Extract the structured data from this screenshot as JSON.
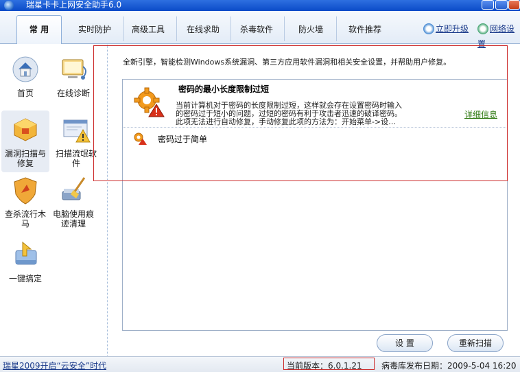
{
  "window": {
    "title": "瑞星卡卡上网安全助手6.0"
  },
  "tabs": [
    {
      "label": "常 用",
      "active": true
    },
    {
      "label": "实时防护"
    },
    {
      "label": "高级工具"
    },
    {
      "label": "在线求助"
    },
    {
      "label": "杀毒软件"
    },
    {
      "label": "防火墙"
    },
    {
      "label": "软件推荐"
    }
  ],
  "top_actions": {
    "upgrade": "立即升级",
    "network": "网络设置"
  },
  "sidebar": {
    "items": [
      {
        "label": "首页",
        "icon": "home-icon"
      },
      {
        "label": "在线诊断",
        "icon": "diagnose-icon"
      },
      {
        "label": "漏洞扫描与修复",
        "icon": "vuln-scan-icon",
        "active": true
      },
      {
        "label": "扫描流氓软件",
        "icon": "rogue-scan-icon"
      },
      {
        "label": "查杀流行木马",
        "icon": "trojan-kill-icon"
      },
      {
        "label": "电脑使用痕迹清理",
        "icon": "broom-icon"
      },
      {
        "label": "一键搞定",
        "icon": "one-click-icon"
      }
    ]
  },
  "main": {
    "intro": "全新引擎，智能检测Windows系统漏洞、第三方应用软件漏洞和相关安全设置，并帮助用户修复。",
    "issue1": {
      "title": "密码的最小长度限制过短",
      "desc_line1": "当前计算机对于密码的长度限制过短，这样就会存在设置密码时输入",
      "desc_line2": "的密码过于短小的问题，过短的密码有利于攻击者迅速的破译密码。",
      "desc_line3": "此项无法进行自动修复，手动修复此项的方法为：开始菜单->设…",
      "detail_link": "详细信息"
    },
    "issue2": {
      "label": "密码过于简单"
    }
  },
  "buttons": {
    "settings": "设 置",
    "rescan": "重新扫描"
  },
  "status": {
    "left": "瑞星2009开启“云安全”时代",
    "version": "当前版本：6.0.1.21",
    "virus_date": "病毒库发布日期：2009-5-04 16:20"
  },
  "colors": {
    "accent": "#2d6fe0",
    "link_green": "#2f7a12",
    "highlight_red": "#cc2a2a"
  }
}
